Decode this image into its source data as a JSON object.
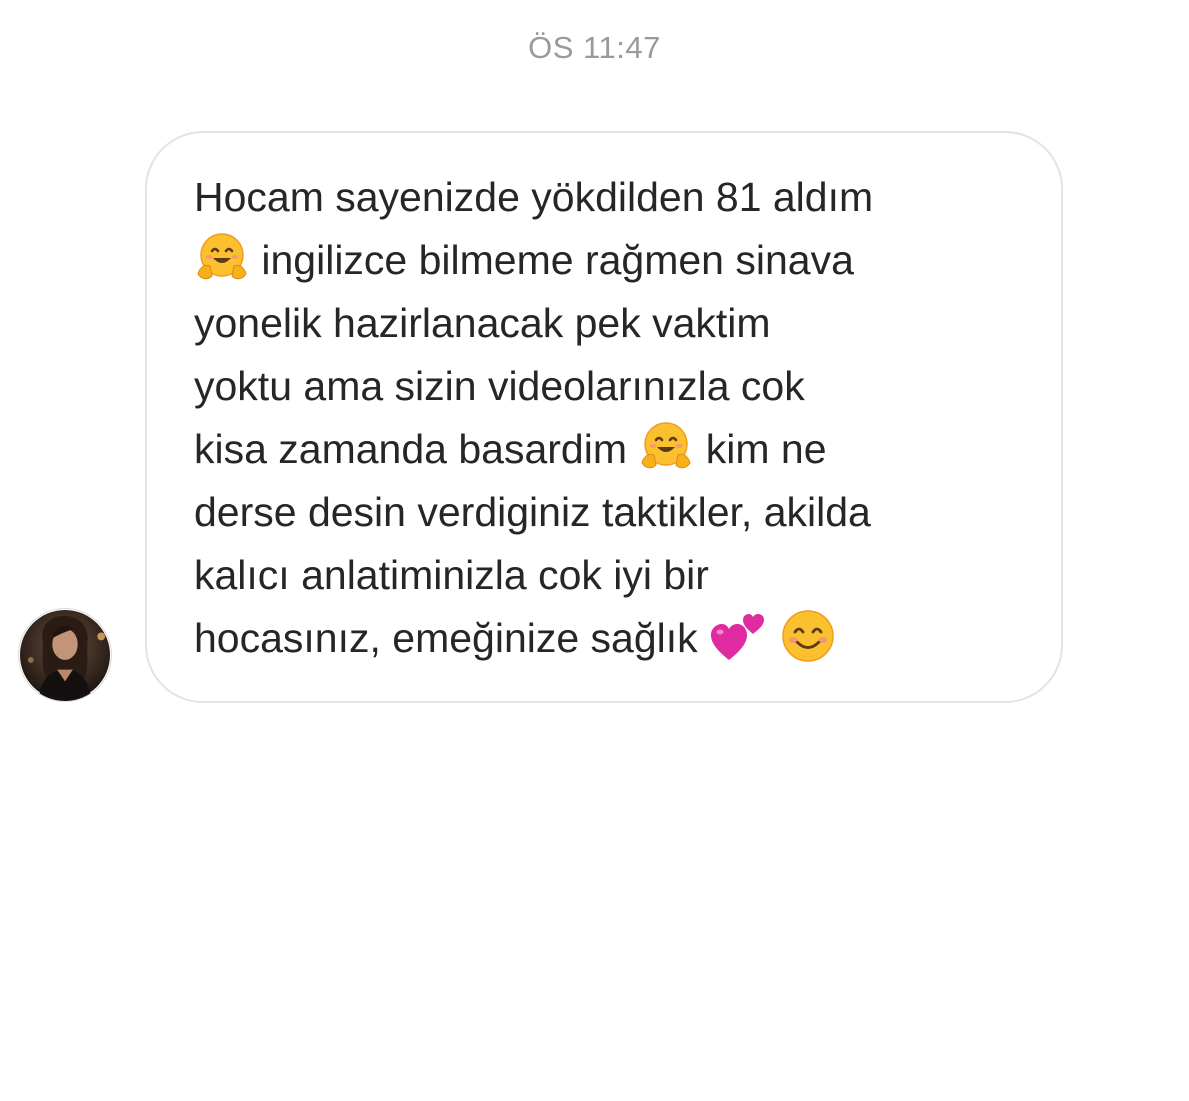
{
  "conversation": {
    "timestamp": "ÖS 11:47"
  },
  "message": {
    "lines": {
      "l1": "Hocam sayenizde yökdilden 81 aldım",
      "l2_after_emoji": " ingilizce bilmeme rağmen sinava",
      "l3": "yonelik hazirlanacak pek vaktim",
      "l4": "yoktu ama sizin videolarınızla cok",
      "l5_before_emoji": "kisa zamanda basardim ",
      "l5_after_emoji": " kim ne",
      "l6": "derse desin verdiginiz taktikler, akilda",
      "l7": "kalıcı anlatiminizla cok iyi bir",
      "l8_before_emoji": "hocasınız, emeğinize sağlık "
    },
    "emojis": [
      "hugging-face-icon",
      "hugging-face-icon",
      "two-hearts-icon",
      "smiling-face-icon"
    ]
  },
  "colors": {
    "bubble_border": "#e3e3e3",
    "text": "#262626",
    "timestamp": "#9a9a9a"
  }
}
